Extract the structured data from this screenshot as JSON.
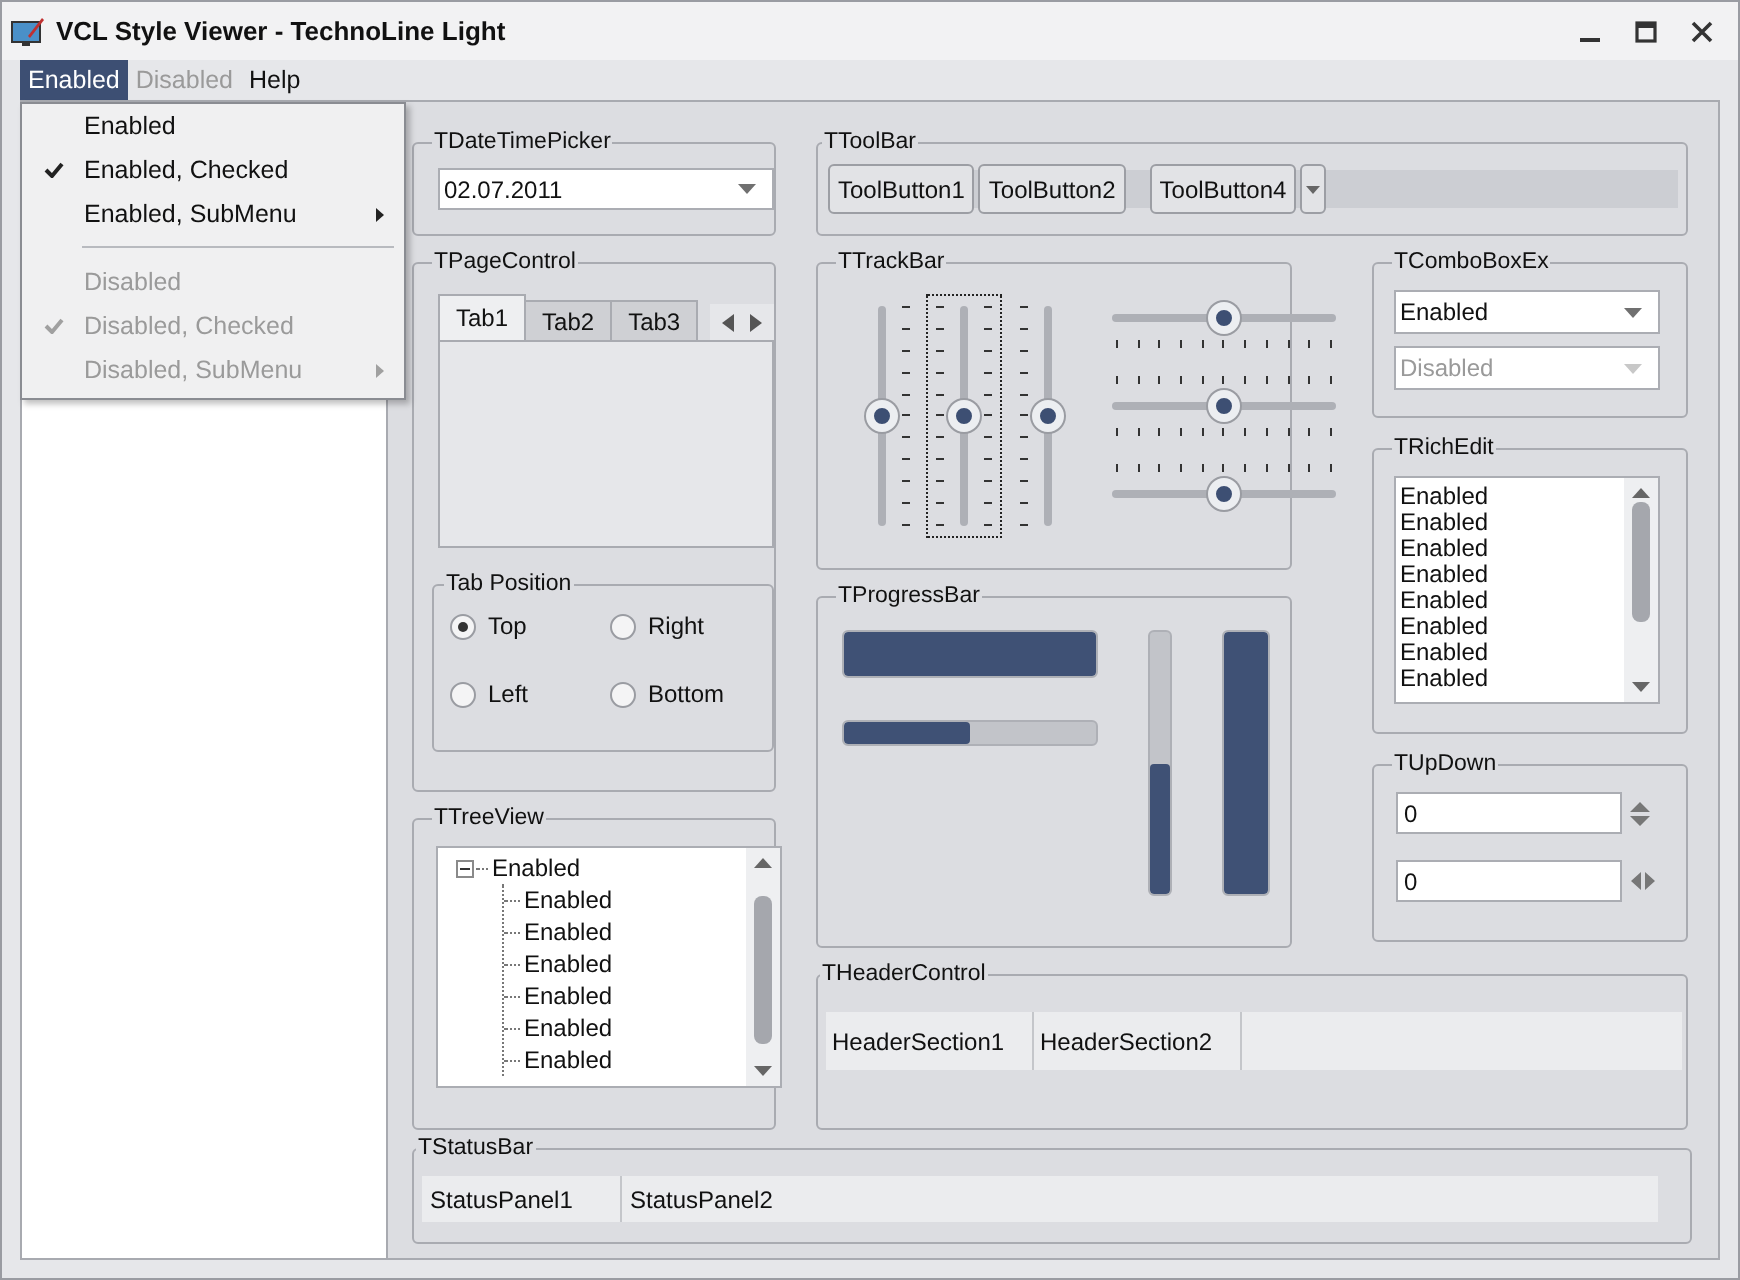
{
  "window": {
    "title": "VCL Style Viewer - TechnoLine Light"
  },
  "menu_bar": [
    {
      "label": "Enabled",
      "selected": true,
      "disabled": false
    },
    {
      "label": "Disabled",
      "selected": false,
      "disabled": true
    },
    {
      "label": "Help",
      "selected": false,
      "disabled": false
    }
  ],
  "dropdown_menu": [
    {
      "kind": "item",
      "label": "Enabled",
      "checked": false,
      "disabled": false,
      "submenu": false
    },
    {
      "kind": "item",
      "label": "Enabled, Checked",
      "checked": true,
      "disabled": false,
      "submenu": false
    },
    {
      "kind": "item",
      "label": "Enabled, SubMenu",
      "checked": false,
      "disabled": false,
      "submenu": true
    },
    {
      "kind": "separator"
    },
    {
      "kind": "item",
      "label": "Disabled",
      "checked": false,
      "disabled": true,
      "submenu": false
    },
    {
      "kind": "item",
      "label": "Disabled, Checked",
      "checked": true,
      "disabled": true,
      "submenu": false
    },
    {
      "kind": "item",
      "label": "Disabled, SubMenu",
      "checked": false,
      "disabled": true,
      "submenu": true
    }
  ],
  "date_time_picker": {
    "title": "TDateTimePicker",
    "value": "02.07.2011"
  },
  "toolbar": {
    "title": "TToolBar",
    "buttons": [
      {
        "kind": "button",
        "label": "ToolButton1"
      },
      {
        "kind": "button",
        "label": "ToolButton2"
      },
      {
        "kind": "separator"
      },
      {
        "kind": "button",
        "label": "ToolButton4"
      },
      {
        "kind": "dropdown"
      }
    ]
  },
  "page_control": {
    "title": "TPageControl",
    "tabs": [
      {
        "label": "Tab1",
        "selected": true
      },
      {
        "label": "Tab2",
        "selected": false
      },
      {
        "label": "Tab3",
        "selected": false
      }
    ],
    "tab_position": {
      "title": "Tab Position",
      "options": [
        {
          "label": "Top",
          "selected": true
        },
        {
          "label": "Right",
          "selected": false
        },
        {
          "label": "Left",
          "selected": false
        },
        {
          "label": "Bottom",
          "selected": false
        }
      ]
    }
  },
  "tree_view": {
    "title": "TTreeView",
    "nodes": [
      {
        "label": "Enabled",
        "expanded": true,
        "children": [
          {
            "label": "Enabled"
          },
          {
            "label": "Enabled"
          },
          {
            "label": "Enabled"
          },
          {
            "label": "Enabled"
          },
          {
            "label": "Enabled"
          },
          {
            "label": "Enabled"
          }
        ]
      }
    ]
  },
  "trackbar": {
    "title": "TTrackBar",
    "sliders": [
      {
        "kind": "vertical",
        "ticks_before": false,
        "ticks_after": true,
        "level": 0.5,
        "focused": false
      },
      {
        "kind": "vertical",
        "ticks_before": true,
        "ticks_after": true,
        "level": 0.5,
        "focused": true
      },
      {
        "kind": "vertical",
        "ticks_before": true,
        "ticks_after": false,
        "level": 0.5,
        "focused": false
      },
      {
        "kind": "horizontal",
        "ticks_before": false,
        "ticks_after": true,
        "level": 0.5,
        "focused": false
      },
      {
        "kind": "horizontal",
        "ticks_before": true,
        "ticks_after": true,
        "level": 0.5,
        "focused": false
      },
      {
        "kind": "horizontal",
        "ticks_before": true,
        "ticks_after": false,
        "level": 0.5,
        "focused": false
      }
    ]
  },
  "progress_bar": {
    "title": "TProgressBar",
    "bars": [
      {
        "kind": "horizontal",
        "thick": true,
        "level": 1
      },
      {
        "kind": "horizontal",
        "thick": false,
        "level": 0.5
      },
      {
        "kind": "vertical",
        "thick": false,
        "level": 0.5
      },
      {
        "kind": "vertical",
        "thick": true,
        "level": 1
      }
    ]
  },
  "combo_box_ex": {
    "title": "TComboBoxEx",
    "combos": [
      {
        "value": "Enabled",
        "disabled": false
      },
      {
        "value": "Disabled",
        "disabled": true
      }
    ]
  },
  "rich_edit": {
    "title": "TRichEdit",
    "lines": [
      "Enabled",
      "Enabled",
      "Enabled",
      "Enabled",
      "Enabled",
      "Enabled",
      "Enabled",
      "Enabled"
    ]
  },
  "up_down": {
    "title": "TUpDown",
    "fields": [
      {
        "value": "0",
        "kind": "vertical"
      },
      {
        "value": "0",
        "kind": "horizontal"
      }
    ]
  },
  "header_control": {
    "title": "THeaderControl",
    "sections": [
      "HeaderSection1",
      "HeaderSection2"
    ]
  },
  "status_bar": {
    "title": "TStatusBar",
    "panels": [
      "StatusPanel1",
      "StatusPanel2"
    ]
  }
}
